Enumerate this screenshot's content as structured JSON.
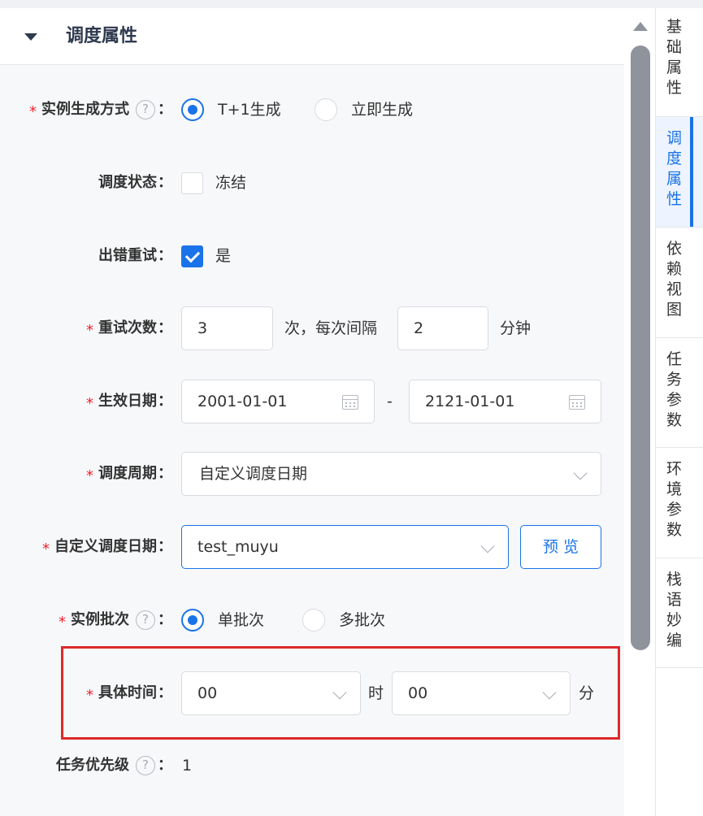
{
  "section": {
    "title": "调度属性"
  },
  "form": {
    "generation": {
      "label": "实例生成方式",
      "option1": "T+1生成",
      "option2": "立即生成",
      "selected": "T+1生成"
    },
    "status": {
      "label": "调度状态",
      "checkbox_label": "冻结",
      "checked": false
    },
    "retry": {
      "label": "出错重试",
      "checkbox_label": "是",
      "checked": true
    },
    "retry_count": {
      "label": "重试次数",
      "count": "3",
      "unit_count": "次，每次间隔",
      "interval": "2",
      "unit_interval": "分钟"
    },
    "effective_date": {
      "label": "生效日期",
      "start": "2001-01-01",
      "separator": "-",
      "end": "2121-01-01"
    },
    "period": {
      "label": "调度周期",
      "value": "自定义调度日期"
    },
    "custom_date": {
      "label": "自定义调度日期",
      "value": "test_muyu",
      "preview_label": "预 览"
    },
    "batch": {
      "label": "实例批次",
      "option1": "单批次",
      "option2": "多批次",
      "selected": "单批次"
    },
    "time": {
      "label": "具体时间",
      "hour": "00",
      "hour_unit": "时",
      "minute": "00",
      "minute_unit": "分"
    },
    "priority": {
      "label": "任务优先级",
      "value": "1"
    }
  },
  "help_glyph": "?",
  "colon": "：",
  "required_mark": "*",
  "rail": {
    "items": [
      {
        "label": "基础属性",
        "active": false
      },
      {
        "label": "调度属性",
        "active": true
      },
      {
        "label": "依赖视图",
        "active": false
      },
      {
        "label": "任务参数",
        "active": false
      },
      {
        "label": "环境参数",
        "active": false
      },
      {
        "label": "栈语妙编",
        "active": false
      }
    ]
  },
  "colors": {
    "accent": "#1a73e8",
    "required": "#f5222d",
    "highlight": "#dd2a2a"
  }
}
